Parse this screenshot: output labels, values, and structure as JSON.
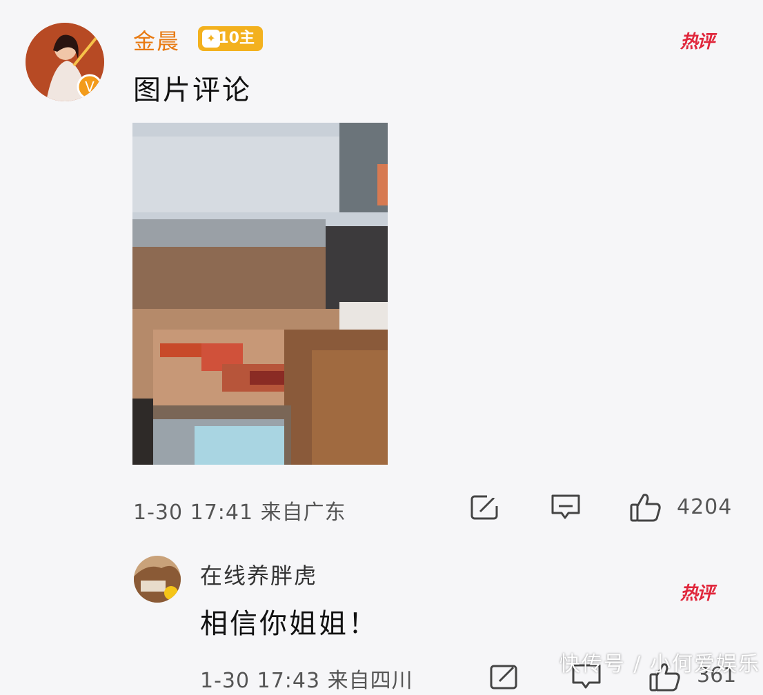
{
  "comment1": {
    "username": "金晨",
    "level_badge": "10主",
    "hot_tag": "热评",
    "text": "图片评论",
    "meta": "1-30 17:41 来自广东",
    "likes": "4204",
    "icons": {
      "share": "share-icon",
      "comment": "comment-icon",
      "like": "thumbs-up-icon"
    }
  },
  "comment2": {
    "username": "在线养胖虎",
    "hot_tag": "热评",
    "text": "相信你姐姐！",
    "meta": "1-30 17:43 来自四川",
    "likes": "361"
  },
  "watermark": "快传号 / 小何爱娱乐",
  "colors": {
    "username": "#e87a12",
    "hot_tag": "#e0263b",
    "badge": "#f3b11e",
    "background": "#f6f6f8"
  }
}
